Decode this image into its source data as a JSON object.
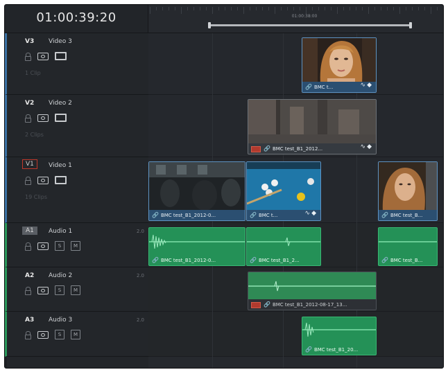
{
  "timeline": {
    "timecode": "01:00:39:20",
    "ruler_timecode": "01:00:38:00"
  },
  "tracks": [
    {
      "id": "V3",
      "name": "Video 3",
      "count": "1 Clip",
      "kind": "video"
    },
    {
      "id": "V2",
      "name": "Video 2",
      "count": "2 Clips",
      "kind": "video"
    },
    {
      "id": "V1",
      "name": "Video 1",
      "count": "19 Clips",
      "kind": "video"
    },
    {
      "id": "A1",
      "name": "Audio 1",
      "channels": "2.0",
      "kind": "audio"
    },
    {
      "id": "A2",
      "name": "Audio 2",
      "channels": "2.0",
      "kind": "audio"
    },
    {
      "id": "A3",
      "name": "Audio 3",
      "channels": "2.0",
      "kind": "audio"
    }
  ],
  "controls": {
    "solo": "S",
    "mute": "M"
  },
  "clips": {
    "v3_clip": "BMC t...",
    "v2_clip": "BMC test_B1_2012...",
    "v1_clip_a": "BMC test_B1_2012-0...",
    "v1_clip_b": "BMC t...",
    "v1_clip_c": "BMC test_B...",
    "a1_clip_a": "BMC test_B1_2012-0...",
    "a1_clip_b": "BMC test_B1_2...",
    "a1_clip_c": "BMC test_B...",
    "a2_clip": "BMC test_B1_2012-08-17_13...",
    "a3_clip": "BMC test_B1_20..."
  },
  "icons": {
    "lock": "lock-icon",
    "eye": "visibility-icon",
    "monitor": "monitor-icon",
    "link": "link-icon",
    "curve": "curve-icon",
    "keyframe": "keyframe-icon"
  },
  "colors": {
    "video_accent": "#3b73a6",
    "audio_accent": "#2b9a5c",
    "audio_clip": "#249157",
    "video_bar": "#2b4f71",
    "record_red": "#c0392b"
  }
}
